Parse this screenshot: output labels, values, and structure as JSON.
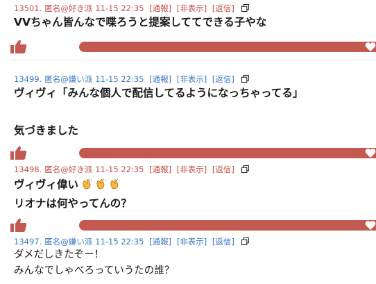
{
  "colors": {
    "like": "#c0504d",
    "hate": "#3a78c2",
    "bar": "#c35a51"
  },
  "actions": {
    "report": "[通報]",
    "hide": "[非表示]",
    "reply": "[返信]"
  },
  "posts": [
    {
      "num": "13501.",
      "name": "匿名@好き派",
      "date": "11-15 22:35",
      "lines": [
        "VVちゃん皆んなで喋ろうと提案しててできる子やな"
      ]
    },
    {
      "num": "13499.",
      "name": "匿名@嫌い派",
      "date": "11-15 22:35",
      "lines": [
        "ヴィヴィ「みんな個人で配信してるようになっちゃってる」",
        "気づきました"
      ]
    },
    {
      "num": "13498.",
      "name": "匿名@好き派",
      "date": "11-15 22:35",
      "lines": [
        "ヴィヴィ偉い",
        "リオナは何やってんの？"
      ]
    },
    {
      "num": "13497.",
      "name": "匿名@嫌い派",
      "date": "11-15 22:35",
      "lines": [
        "ダメだしきたぞー！",
        "みんなでしゃべろっていうたの誰？"
      ]
    }
  ],
  "icons": {
    "thumb": "thumbs-up-icon",
    "heart": "heart-icon",
    "copy": "copy-icon",
    "clap": "clapping-hands-icon"
  }
}
